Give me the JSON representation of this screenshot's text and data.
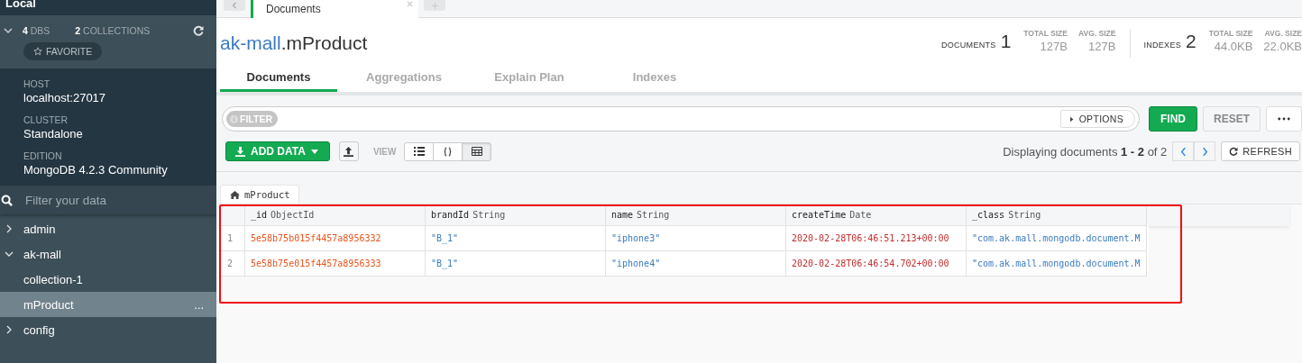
{
  "sidebar": {
    "title": "Local",
    "expanded": true,
    "dbs": {
      "count": "4",
      "label": "DBS"
    },
    "collections": {
      "count": "2",
      "label": "COLLECTIONS"
    },
    "favorite": "FAVORITE",
    "info": [
      {
        "label": "HOST",
        "value": "localhost:27017"
      },
      {
        "label": "CLUSTER",
        "value": "Standalone"
      },
      {
        "label": "EDITION",
        "value": "MongoDB 4.2.3 Community"
      }
    ],
    "filter": {
      "placeholder": "Filter your data"
    },
    "tree": [
      {
        "label": "admin",
        "expanded": false
      },
      {
        "label": "ak-mall",
        "expanded": true,
        "children": [
          {
            "label": "collection-1",
            "selected": false
          },
          {
            "label": "mProduct",
            "selected": true,
            "menu": "..."
          }
        ]
      },
      {
        "label": "config",
        "expanded": false
      }
    ]
  },
  "tab_strip": {
    "tabs": [
      {
        "label": "Documents",
        "selected": true
      }
    ]
  },
  "title_parts": [
    {
      "text": "ak-mall",
      "kind": "database"
    },
    {
      "text": ".mProduct",
      "kind": "collection"
    }
  ],
  "stats": [
    {
      "label": "DOCUMENTS",
      "count": "1",
      "sizes": [
        {
          "label": "TOTAL SIZE",
          "value": "127B"
        },
        {
          "label": "AVG. SIZE",
          "value": "127B"
        }
      ]
    },
    {
      "label": "INDEXES",
      "count": "2",
      "sizes": [
        {
          "label": "TOTAL SIZE",
          "value": "44.0KB"
        },
        {
          "label": "AVG. SIZE",
          "value": "22.0KB"
        }
      ]
    }
  ],
  "tabs": [
    {
      "label": "Documents",
      "selected": true
    },
    {
      "label": "Aggregations",
      "selected": false
    },
    {
      "label": "Explain Plan",
      "selected": false
    },
    {
      "label": "Indexes",
      "selected": false
    }
  ],
  "query_bar": {
    "filter_label": "FILTER",
    "options": "OPTIONS",
    "find": "FIND",
    "reset": "RESET"
  },
  "toolbar": {
    "add_data": "ADD DATA",
    "view_label": "VIEW",
    "views": [
      {
        "kind": "list",
        "selected": false
      },
      {
        "kind": "json",
        "selected": false
      },
      {
        "kind": "table",
        "selected": true
      }
    ],
    "paging": "Displaying documents **1 - 2** of 2",
    "refresh": "REFRESH"
  },
  "collection_tab": "mProduct",
  "table": {
    "columns": [
      {
        "name": "_id",
        "type": "ObjectId",
        "kind": "objectid"
      },
      {
        "name": "brandId",
        "type": "String",
        "kind": "string"
      },
      {
        "name": "name",
        "type": "String",
        "kind": "string"
      },
      {
        "name": "createTime",
        "type": "Date",
        "kind": "date"
      },
      {
        "name": "_class",
        "type": "String",
        "kind": "string"
      }
    ],
    "rows": [
      {
        "number": "1",
        "cells": [
          "5e58b75b015f4457a8956332",
          "\"B_1\"",
          "\"iphone3\"",
          "2020-02-28T06:46:51.213+00:00",
          "\"com.ak.mall.mongodb.document.M"
        ]
      },
      {
        "number": "2",
        "cells": [
          "5e58b75e015f4457a8956333",
          "\"B_1\"",
          "\"iphone4\"",
          "2020-02-28T06:46:54.702+00:00",
          "\"com.ak.mall.mongodb.document.M"
        ]
      }
    ]
  }
}
